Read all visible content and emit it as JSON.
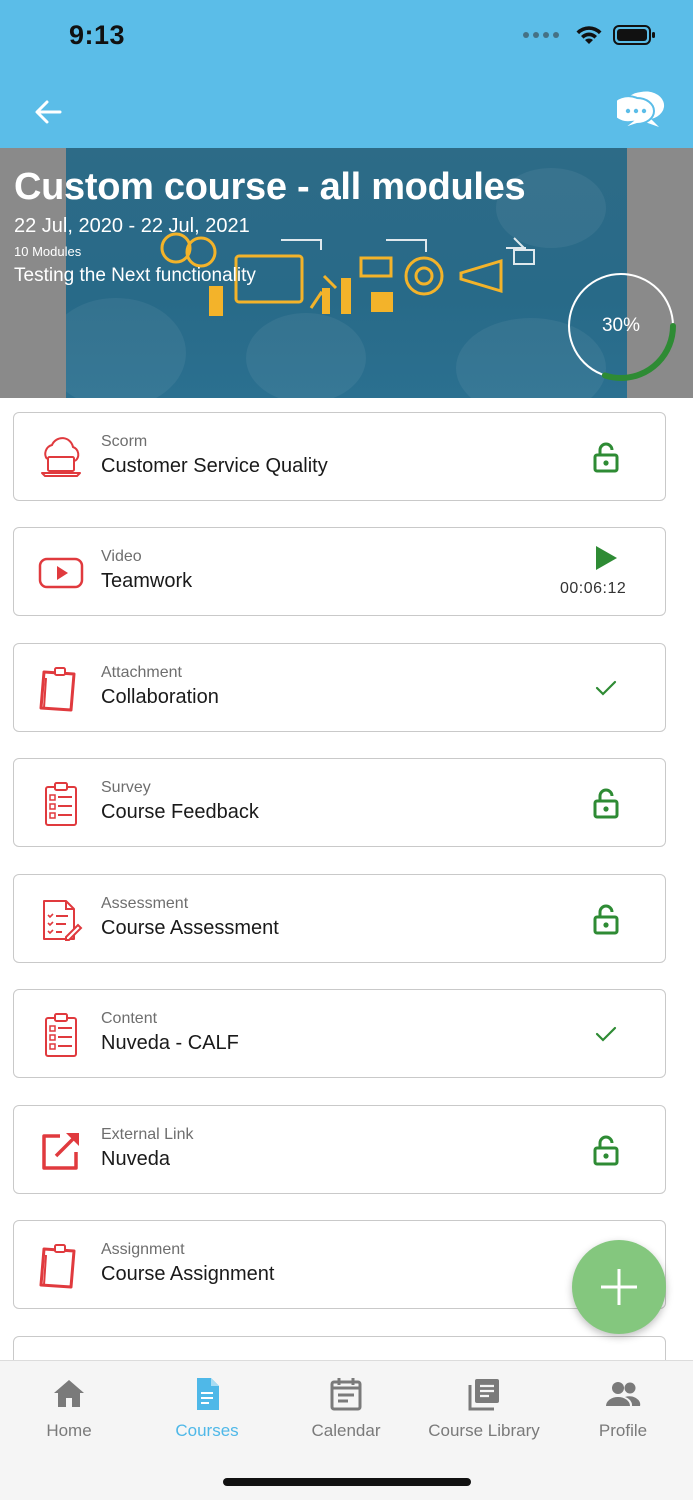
{
  "status_bar": {
    "time": "9:13"
  },
  "header": {
    "back_icon": "arrow-left-icon",
    "chat_icon": "chat-bubbles-icon"
  },
  "course": {
    "title": "Custom course - all modules",
    "dates": "22 Jul, 2020  -  22 Jul, 2021",
    "modules_count": "10 Modules",
    "description": "Testing the Next functionality",
    "progress_label": "30%",
    "progress_value": 0.3
  },
  "modules": [
    {
      "type": "Scorm",
      "title": "Customer Service Quality",
      "icon": "cloud-laptop-icon",
      "status": "unlocked"
    },
    {
      "type": "Video",
      "title": "Teamwork",
      "icon": "video-play-icon",
      "status": "play",
      "duration": "00:06:12"
    },
    {
      "type": "Attachment",
      "title": "Collaboration",
      "icon": "clipboard-icon",
      "status": "completed"
    },
    {
      "type": "Survey",
      "title": "Course Feedback",
      "icon": "checklist-icon",
      "status": "unlocked"
    },
    {
      "type": "Assessment",
      "title": "Course Assessment",
      "icon": "assessment-icon",
      "status": "unlocked"
    },
    {
      "type": "Content",
      "title": "Nuveda - CALF",
      "icon": "checklist-icon",
      "status": "completed"
    },
    {
      "type": "External Link",
      "title": "Nuveda",
      "icon": "external-link-icon",
      "status": "unlocked"
    },
    {
      "type": "Assignment",
      "title": "Course Assignment",
      "icon": "clipboard-icon",
      "status": "unlocked"
    }
  ],
  "fab": {
    "icon": "plus-icon"
  },
  "tabs": [
    {
      "label": "Home",
      "icon": "home-icon",
      "active": false
    },
    {
      "label": "Courses",
      "icon": "document-icon",
      "active": true
    },
    {
      "label": "Calendar",
      "icon": "calendar-icon",
      "active": false
    },
    {
      "label": "Course Library",
      "icon": "library-icon",
      "active": false
    },
    {
      "label": "Profile",
      "icon": "people-icon",
      "active": false
    }
  ],
  "colors": {
    "header": "#5bbde8",
    "accent_red": "#e03a3e",
    "accent_green": "#2e8b34",
    "fab": "#84c77e",
    "active_tab": "#4fb8e8"
  }
}
